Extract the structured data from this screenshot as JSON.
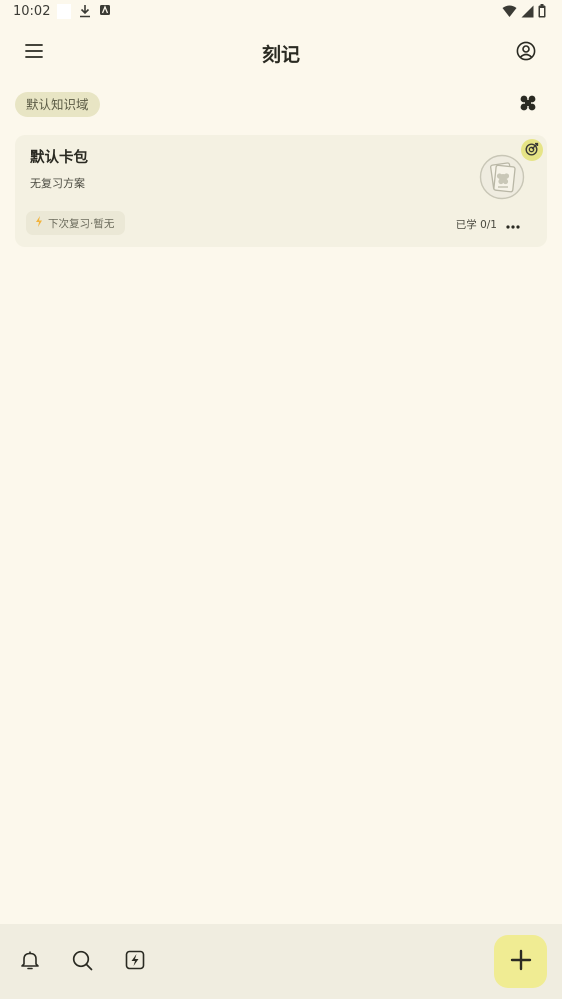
{
  "status_bar": {
    "time": "10:02"
  },
  "header": {
    "title": "刻记",
    "menu_icon": "menu-icon",
    "account_icon": "account-circle-icon"
  },
  "domain": {
    "chip_label": "默认知识域",
    "view_toggle_icon": "grid-view-icon"
  },
  "deck": {
    "title": "默认卡包",
    "subtitle": "无复习方案",
    "next_review": "下次复习·暂无",
    "progress": "已学 0/1",
    "thumbnail_icon": "deck-thumbnail-icon",
    "badge_icon": "checkin-badge-icon"
  },
  "bottom_bar": {
    "items": [
      "bell-icon",
      "search-icon",
      "flash-card-icon"
    ],
    "fab_icon": "plus-icon"
  },
  "colors": {
    "background": "#fcf8ec",
    "card": "#f4f1e2",
    "chip": "#e8e5c4",
    "fab": "#f0ec93",
    "accent_bolt": "#f2b33c"
  }
}
